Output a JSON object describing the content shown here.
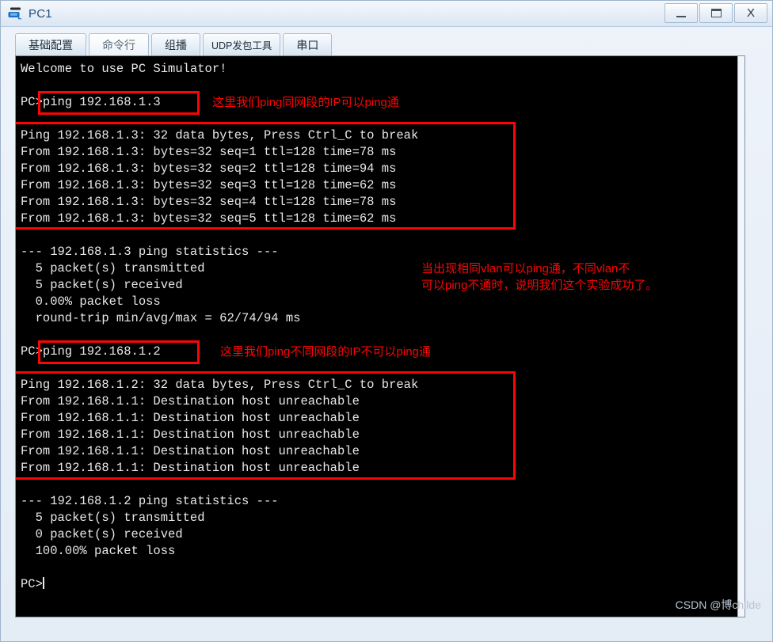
{
  "window": {
    "title": "PC1",
    "icon": "pc-device-icon",
    "controls": {
      "minimize": "minimize-icon",
      "maximize": "maximize-icon",
      "close": "X"
    }
  },
  "tabs": [
    {
      "label": "基础配置",
      "active": false,
      "small": false
    },
    {
      "label": "命令行",
      "active": true,
      "small": false
    },
    {
      "label": "组播",
      "active": false,
      "small": false
    },
    {
      "label": "UDP发包工具",
      "active": false,
      "small": true
    },
    {
      "label": "串口",
      "active": false,
      "small": false
    }
  ],
  "terminal": {
    "lines": [
      "Welcome to use PC Simulator!",
      "",
      "PC>ping 192.168.1.3",
      "",
      "Ping 192.168.1.3: 32 data bytes, Press Ctrl_C to break",
      "From 192.168.1.3: bytes=32 seq=1 ttl=128 time=78 ms",
      "From 192.168.1.3: bytes=32 seq=2 ttl=128 time=94 ms",
      "From 192.168.1.3: bytes=32 seq=3 ttl=128 time=62 ms",
      "From 192.168.1.3: bytes=32 seq=4 ttl=128 time=78 ms",
      "From 192.168.1.3: bytes=32 seq=5 ttl=128 time=62 ms",
      "",
      "--- 192.168.1.3 ping statistics ---",
      "  5 packet(s) transmitted",
      "  5 packet(s) received",
      "  0.00% packet loss",
      "  round-trip min/avg/max = 62/74/94 ms",
      "",
      "PC>ping 192.168.1.2",
      "",
      "Ping 192.168.1.2: 32 data bytes, Press Ctrl_C to break",
      "From 192.168.1.1: Destination host unreachable",
      "From 192.168.1.1: Destination host unreachable",
      "From 192.168.1.1: Destination host unreachable",
      "From 192.168.1.1: Destination host unreachable",
      "From 192.168.1.1: Destination host unreachable",
      "",
      "--- 192.168.1.2 ping statistics ---",
      "  5 packet(s) transmitted",
      "  0 packet(s) received",
      "  100.00% packet loss",
      "",
      "PC>"
    ],
    "prompt_cursor": true
  },
  "annotations": [
    {
      "id": "annot-same-subnet",
      "text": "这里我们ping同网段的IP可以ping通"
    },
    {
      "id": "annot-conclusion-line1",
      "text": "当出现相同vlan可以ping通，不同vlan不"
    },
    {
      "id": "annot-conclusion-line2",
      "text": "可以ping不通时，说明我们这个实验成功了。"
    },
    {
      "id": "annot-diff-subnet",
      "text": "这里我们ping不同网段的IP不可以ping通"
    }
  ],
  "watermark": "CSDN @博childe",
  "colors": {
    "annotation_red": "#fb0505",
    "terminal_bg": "#000000",
    "terminal_fg": "#e8e8e8",
    "title_text": "#1f4e79"
  }
}
